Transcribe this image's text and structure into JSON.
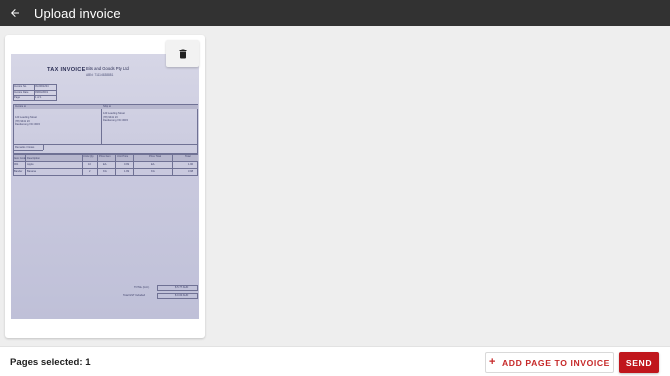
{
  "appbar": {
    "title": "Upload invoice",
    "back_icon": "arrow-left-icon",
    "background": "#323232"
  },
  "page_card": {
    "delete_icon": "trash-icon",
    "invoice": {
      "heading": "TAX INVOICE",
      "company": "Bits and Goods Pty Ltd",
      "abn": "ABN: 71114638881",
      "invoice_fields": [
        "Invoice No.",
        "Invoice Date",
        "Page"
      ],
      "invoice_values": [
        "IN-0001234",
        "03/04/2019",
        "1 of 1"
      ],
      "bill_to_label": "Invoice to",
      "ship_to_label": "Ship to",
      "address_lines": [
        "123 Leeding Street",
        "(78) 9441 23",
        "Dandenong VIC 3015"
      ],
      "remarks_label": "Remarks / Notes",
      "columns": [
        "Item Code",
        "Description",
        "Units Qty",
        "Price Item",
        "Unit Price",
        "Price Total",
        "Total"
      ],
      "rows": [
        [
          "001",
          "Apple",
          "10",
          "EA",
          "0.99",
          "EA",
          "1.90"
        ],
        [
          "Bander",
          "Banana",
          "2",
          "KG",
          "1.99",
          "KG",
          "3.98"
        ]
      ],
      "total_label": "TOTAL (Incl.)",
      "total_value": "$ 5.77 AUD",
      "gst_label": "Total GST Included",
      "gst_value": "$ 0.00 AUD"
    }
  },
  "bottombar": {
    "pages_label": "Pages selected:",
    "pages_count": "1",
    "add_page_label": "ADD PAGE TO INVOICE",
    "add_icon": "plus-icon",
    "send_label": "SEND"
  },
  "colors": {
    "accent": "#c0161c",
    "appbar": "#323232",
    "background": "#eeeeee"
  }
}
